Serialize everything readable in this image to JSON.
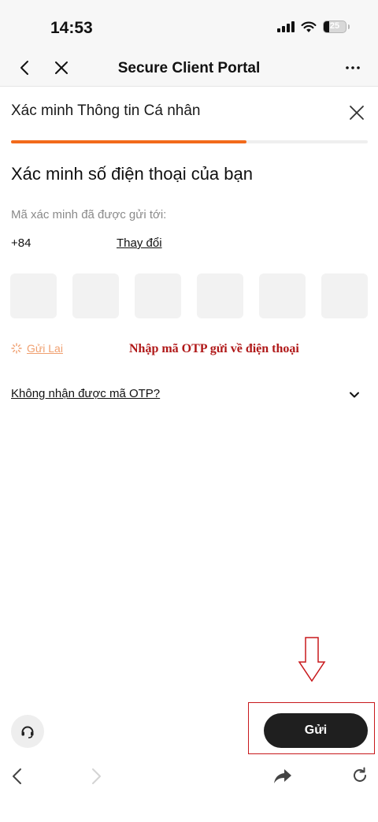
{
  "status_bar": {
    "time": "14:53",
    "battery_percent": "25",
    "battery_level": 0.25
  },
  "nav": {
    "title": "Secure Client Portal"
  },
  "sheet": {
    "title": "Xác minh Thông tin Cá nhân",
    "progress": 0.66,
    "accent_color": "#f26a1b"
  },
  "verify": {
    "heading": "Xác minh số điện thoại của bạn",
    "sent_to_label": "Mã xác minh đã được gửi tới:",
    "phone_prefix": "+84",
    "change_label": "Thay đổi",
    "otp_digits": [
      "",
      "",
      "",
      "",
      "",
      ""
    ],
    "resend_label": "Gửi Lai",
    "annotation": "Nhập mã OTP gửi về điện thoại",
    "no_code_label": "Không nhận được mã OTP?"
  },
  "footer": {
    "submit_label": "Gửi",
    "support_icon": "headset-icon"
  },
  "browser_toolbar": {
    "icons": [
      "back-icon",
      "forward-icon",
      "share-icon",
      "reload-icon"
    ]
  }
}
